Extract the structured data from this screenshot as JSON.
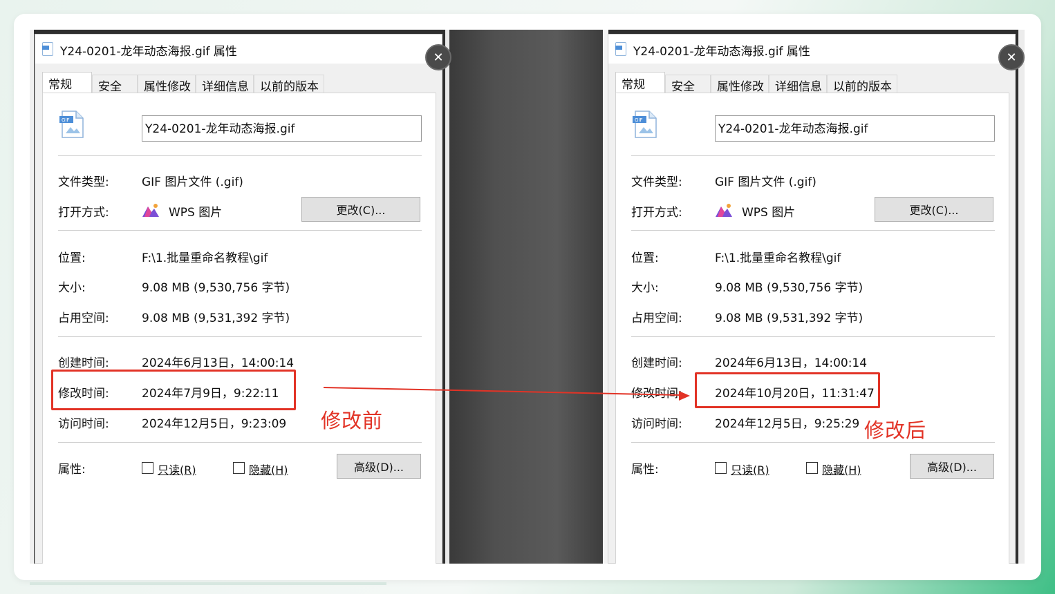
{
  "dialogs": [
    {
      "title": "Y24-0201-龙年动态海报.gif 属性",
      "tabs": [
        "常规",
        "安全",
        "属性修改",
        "详细信息",
        "以前的版本"
      ],
      "file_name": "Y24-0201-龙年动态海报.gif",
      "rows": {
        "type_label": "文件类型:",
        "type_value": "GIF 图片文件 (.gif)",
        "open_label": "打开方式:",
        "open_value": "WPS 图片",
        "change_button": "更改(C)...",
        "location_label": "位置:",
        "location_value": "F:\\1.批量重命名教程\\gif",
        "size_label": "大小:",
        "size_value": "9.08 MB (9,530,756 字节)",
        "disk_label": "占用空间:",
        "disk_value": "9.08 MB (9,531,392 字节)",
        "created_label": "创建时间:",
        "created_value": "2024年6月13日，14:00:14",
        "modified_label": "修改时间:",
        "modified_value": "2024年7月9日，9:22:11",
        "accessed_label": "访问时间:",
        "accessed_value": "2024年12月5日，9:23:09",
        "attr_label": "属性:",
        "readonly_label": "只读(R)",
        "hidden_label": "隐藏(H)",
        "advanced_button": "高级(D)..."
      }
    },
    {
      "title": "Y24-0201-龙年动态海报.gif 属性",
      "tabs": [
        "常规",
        "安全",
        "属性修改",
        "详细信息",
        "以前的版本"
      ],
      "file_name": "Y24-0201-龙年动态海报.gif",
      "rows": {
        "type_label": "文件类型:",
        "type_value": "GIF 图片文件 (.gif)",
        "open_label": "打开方式:",
        "open_value": "WPS 图片",
        "change_button": "更改(C)...",
        "location_label": "位置:",
        "location_value": "F:\\1.批量重命名教程\\gif",
        "size_label": "大小:",
        "size_value": "9.08 MB (9,530,756 字节)",
        "disk_label": "占用空间:",
        "disk_value": "9.08 MB (9,531,392 字节)",
        "created_label": "创建时间:",
        "created_value": "2024年6月13日，14:00:14",
        "modified_label": "修改时间:",
        "modified_value": "2024年10月20日，11:31:47",
        "accessed_label": "访问时间:",
        "accessed_value": "2024年12月5日，9:25:29",
        "attr_label": "属性:",
        "readonly_label": "只读(R)",
        "hidden_label": "隐藏(H)",
        "advanced_button": "高级(D)..."
      }
    }
  ],
  "annotations": {
    "before": "修改前",
    "after": "修改后"
  },
  "icons": {
    "file": "gif-file-icon",
    "app": "wps-pictures-icon",
    "close": "close-icon"
  },
  "colors": {
    "highlight": "#e23326",
    "brand_green": "#3fbf86"
  }
}
